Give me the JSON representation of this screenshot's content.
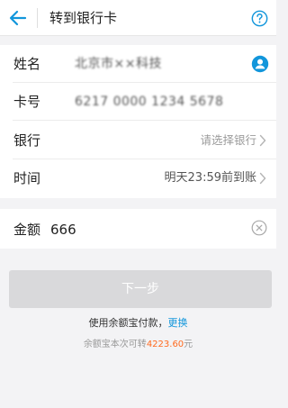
{
  "header": {
    "title": "转到银行卡"
  },
  "form": {
    "name": {
      "label": "姓名",
      "value": "北京市××科技"
    },
    "card": {
      "label": "卡号",
      "value": "6217 0000 1234 5678"
    },
    "bank": {
      "label": "银行",
      "placeholder": "请选择银行"
    },
    "time": {
      "label": "时间",
      "value": "明天23:59前到账"
    },
    "amount": {
      "label": "金额",
      "value": "666"
    }
  },
  "actions": {
    "next_label": "下一步"
  },
  "payment": {
    "text": "使用余额宝付款，",
    "switch_label": "更换"
  },
  "balance": {
    "prefix": "余额宝本次可转",
    "amount": "4223.60",
    "suffix": "元"
  },
  "colors": {
    "accent": "#1296db",
    "highlight": "#ff6a1f",
    "disabled_button": "#d9d9db",
    "background": "#f3f3f5"
  },
  "icons": [
    "back-arrow-icon",
    "help-icon",
    "contact-icon",
    "chevron-right-icon",
    "clear-icon"
  ]
}
